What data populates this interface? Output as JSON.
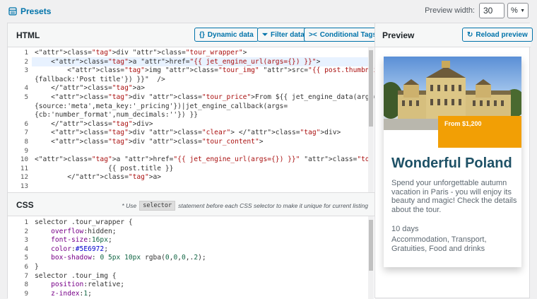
{
  "topbar": {
    "presets_label": "Presets",
    "preview_width_label": "Preview width:",
    "preview_width_value": "30",
    "preview_width_unit": "%"
  },
  "html_section": {
    "title": "HTML",
    "buttons": {
      "dynamic_data": "Dynamic data",
      "filter_data": "Filter data",
      "conditional_tags": "Conditional Tags"
    },
    "line_numbers": [
      "1",
      "2",
      "3",
      "",
      "4",
      "5",
      "",
      "",
      "6",
      "7",
      "8",
      "9",
      "10",
      "11",
      "12",
      "13"
    ],
    "lines": [
      "<div class=\"tour_wrapper\">",
      "    <a href=\"{{ jet_engine_url(args={}) }}\">",
      "        <img class=\"tour_img\" src=\"{{ post.thumbnail }}\" alt=\"{{ jet_engine_data(args=",
      "{fallback:'Post title'}) }}\"  />",
      "    </a>",
      "    <div class=\"tour_price\">From ${{ jet_engine_data(args=",
      "{source:'meta',meta_key:'_pricing'})|jet_engine_callback(args=",
      "{cb:'number_format',num_decimals:''}) }}",
      "    </div>",
      "    <div class=\"clear\"> </div>",
      "    <div class=\"tour_content\">",
      "",
      "<a href=\"{{ jet_engine_url(args={}) }}\" class=\"tour_title\">",
      "                  {{ post.title }}",
      "        </a>",
      ""
    ]
  },
  "css_section": {
    "title": "CSS",
    "note_prefix": "* Use",
    "note_chip": "selector",
    "note_suffix": "statement before each CSS selector to make it unique for current listing",
    "line_numbers": [
      "1",
      "2",
      "3",
      "4",
      "5",
      "6",
      "7",
      "8",
      "9"
    ],
    "lines": [
      "selector .tour_wrapper {",
      "    overflow:hidden;",
      "    font-size:16px;",
      "    color:#5E6972;",
      "    box-shadow: 0 5px 10px rgba(0,0,0,.2);",
      "}",
      "selector .tour_img {",
      "    position:relative;",
      "    z-index:1;"
    ]
  },
  "preview": {
    "title": "Preview",
    "reload_label": "Reload preview",
    "card": {
      "price": "From $1,200",
      "title": "Wonderful Poland",
      "description": "Spend your unforgettable autumn vacation in Paris - you will enjoy its beauty and magic! Check the details about the tour.",
      "days": "10 days",
      "includes": "Accommodation, Transport, Gratuities, Food and drinks"
    }
  },
  "colors": {
    "accent": "#0073aa",
    "price_bg": "#f29f05",
    "title": "#1e5166",
    "text": "#5e6972"
  }
}
